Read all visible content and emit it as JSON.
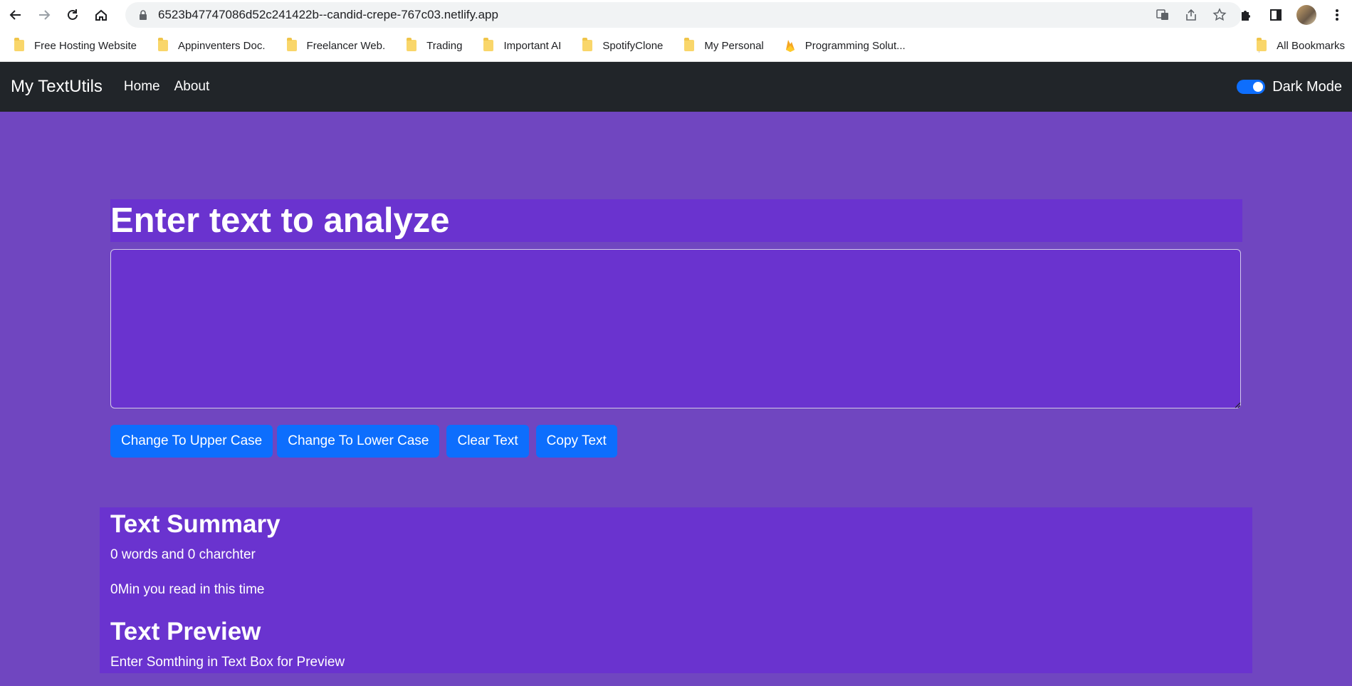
{
  "browser": {
    "url": "6523b47747086d52c241422b--candid-crepe-767c03.netlify.app",
    "bookmarks": [
      {
        "label": "Free Hosting Website",
        "icon": "folder-icon"
      },
      {
        "label": "Appinventers Doc.",
        "icon": "folder-icon"
      },
      {
        "label": "Freelancer Web.",
        "icon": "folder-icon"
      },
      {
        "label": "Trading",
        "icon": "folder-icon"
      },
      {
        "label": "Important AI",
        "icon": "folder-icon"
      },
      {
        "label": "SpotifyClone",
        "icon": "folder-icon"
      },
      {
        "label": "My Personal",
        "icon": "folder-icon"
      },
      {
        "label": "Programming Solut...",
        "icon": "firebase-icon"
      }
    ],
    "all_bookmarks": "All Bookmarks"
  },
  "navbar": {
    "brand": "My TextUtils",
    "links": [
      "Home",
      "About"
    ],
    "dark_mode_label": "Dark Mode",
    "dark_mode_enabled": true
  },
  "main": {
    "heading": "Enter text to analyze",
    "textarea_value": "",
    "buttons": [
      "Change To Upper Case",
      "Change To Lower Case",
      "Clear Text",
      "Copy Text"
    ]
  },
  "summary": {
    "title": "Text Summary",
    "counts": "0 words and 0 charchter",
    "read_time": "0Min you read in this time",
    "preview_title": "Text Preview",
    "preview_text": "Enter Somthing in Text Box for Preview"
  },
  "colors": {
    "page_bg": "#7046c0",
    "panel_bg": "#6a33cf",
    "navbar_bg": "#212529",
    "button_bg": "#0d6efd"
  }
}
